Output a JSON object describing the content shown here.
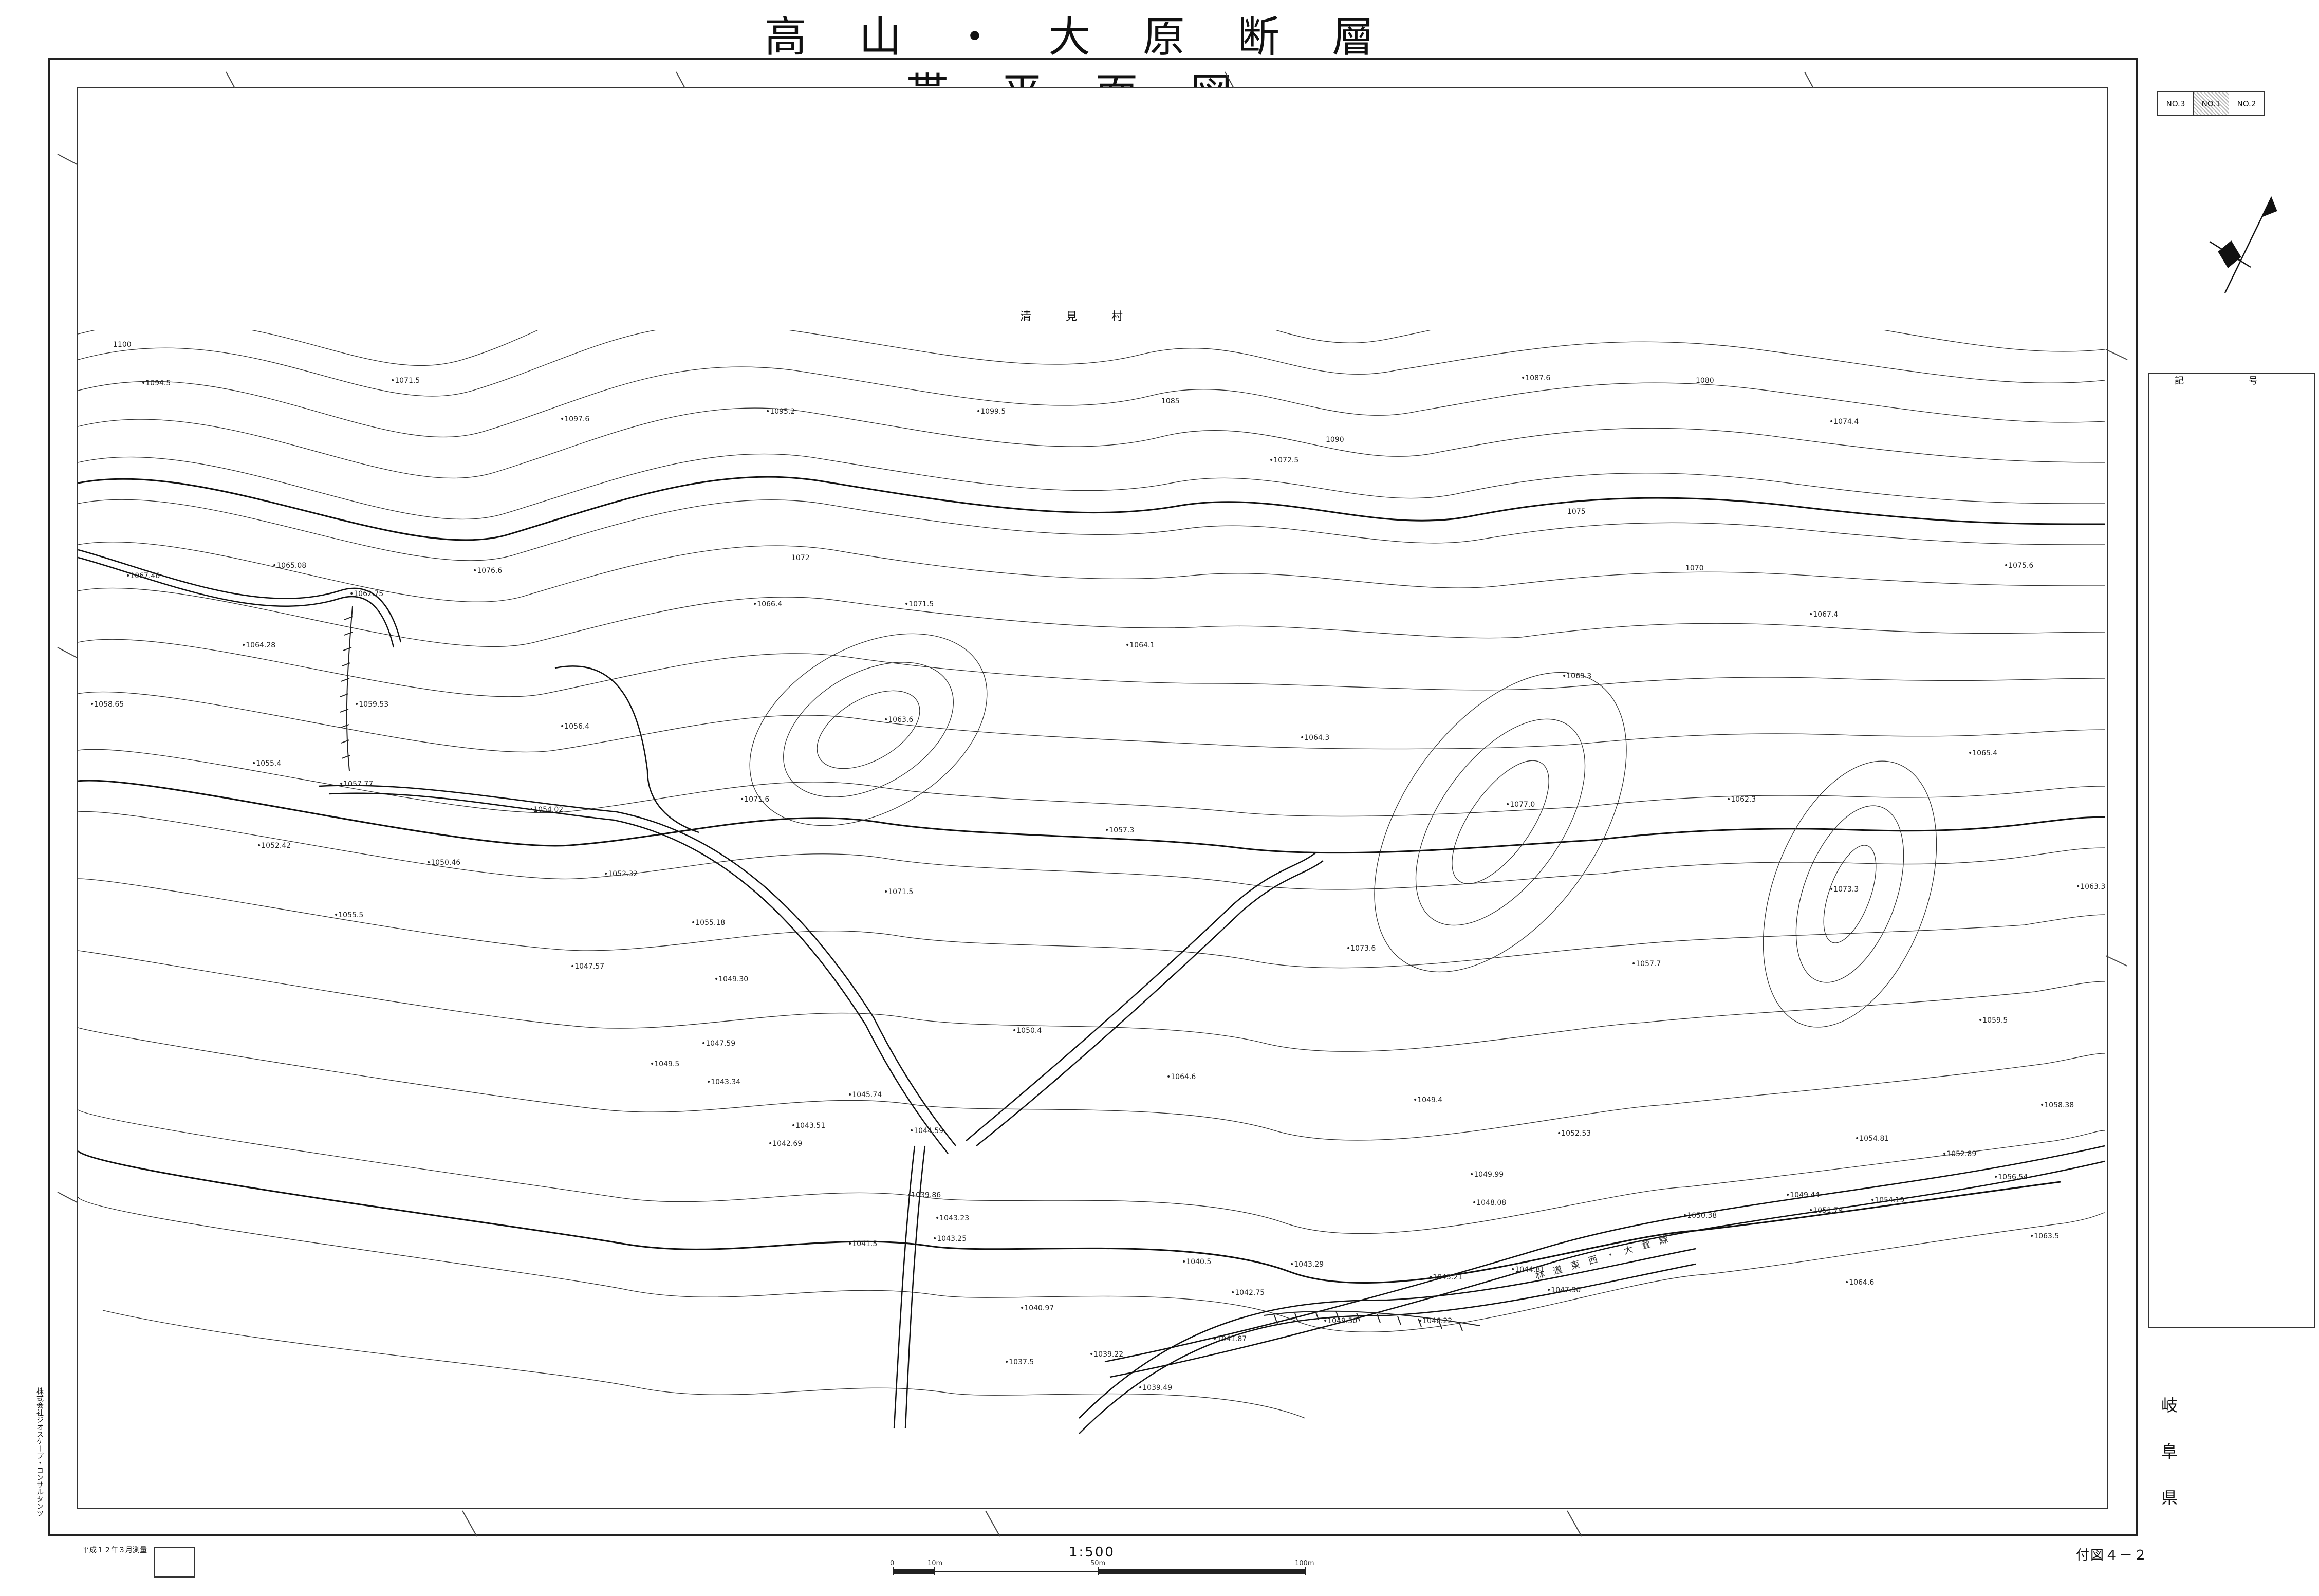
{
  "title": "高 山 ・ 大 原 断 層 帯 平 面 図",
  "village": "清 見 村",
  "sheet_index": [
    "NO.3",
    "NO.1",
    "NO.2"
  ],
  "sheet_index_current": 1,
  "legend": {
    "title": "記 号"
  },
  "prefecture": [
    "岐",
    "阜",
    "県"
  ],
  "scale": "1:500",
  "scale_bar": {
    "labels": [
      "0",
      "10m",
      "50m",
      "100m"
    ]
  },
  "sheet_number": "付図４－２",
  "survey_note": "平成１２年３月測量",
  "company": "株式会社ジオスケープ・コンサルタンツ",
  "elevations": [
    {
      "label": "1100"
    },
    {
      "label": "•1094.5"
    },
    {
      "label": "•1071.5"
    },
    {
      "label": "•1097.6"
    },
    {
      "label": "•1095.2"
    },
    {
      "label": "•1099.5"
    },
    {
      "label": "1085"
    },
    {
      "label": "•1087.6"
    },
    {
      "label": "•1074.4"
    },
    {
      "label": "1080"
    },
    {
      "label": "1090"
    },
    {
      "label": "•1072.5"
    },
    {
      "label": "1075"
    },
    {
      "label": "•1075.6"
    },
    {
      "label": "•1067.46"
    },
    {
      "label": "•1065.08"
    },
    {
      "label": "•1076.6"
    },
    {
      "label": "1072"
    },
    {
      "label": "•1066.4"
    },
    {
      "label": "•1071.5"
    },
    {
      "label": "1070"
    },
    {
      "label": "•1067.4"
    },
    {
      "label": "•1062.75"
    },
    {
      "label": "•1064.28"
    },
    {
      "label": "•1064.1"
    },
    {
      "label": "•1069.3"
    },
    {
      "label": "•1058.65"
    },
    {
      "label": "•1059.53"
    },
    {
      "label": "•1056.4"
    },
    {
      "label": "•1063.6"
    },
    {
      "label": "•1064.3"
    },
    {
      "label": "•1065.4"
    },
    {
      "label": "•1055.4"
    },
    {
      "label": "•1057.77"
    },
    {
      "label": "•1054.02"
    },
    {
      "label": "•1071.6"
    },
    {
      "label": "•1077.0"
    },
    {
      "label": "•1062.3"
    },
    {
      "label": "•1052.42"
    },
    {
      "label": "•1050.46"
    },
    {
      "label": "•1057.3"
    },
    {
      "label": "•1073.3"
    },
    {
      "label": "•1063.3"
    },
    {
      "label": "•1052.32"
    },
    {
      "label": "•1071.5"
    },
    {
      "label": "•1055.5"
    },
    {
      "label": "•1055.18"
    },
    {
      "label": "•1073.6"
    },
    {
      "label": "•1057.7"
    },
    {
      "label": "•1047.57"
    },
    {
      "label": "•1049.30"
    },
    {
      "label": "•1050.4"
    },
    {
      "label": "•1059.5"
    },
    {
      "label": "•1049.5"
    },
    {
      "label": "•1047.59"
    },
    {
      "label": "•1043.34"
    },
    {
      "label": "•1064.6"
    },
    {
      "label": "•1045.74"
    },
    {
      "label": "•1049.4"
    },
    {
      "label": "•1058.38"
    },
    {
      "label": "•1043.51"
    },
    {
      "label": "•1044.59"
    },
    {
      "label": "•1042.69"
    },
    {
      "label": "•1052.53"
    },
    {
      "label": "•1054.81"
    },
    {
      "label": "•1052.89"
    },
    {
      "label": "•1039.86"
    },
    {
      "label": "•1049.99"
    },
    {
      "label": "•1056.54"
    },
    {
      "label": "•1043.23"
    },
    {
      "label": "•1048.08"
    },
    {
      "label": "•1049.44"
    },
    {
      "label": "•1054.19"
    },
    {
      "label": "•1051.79"
    },
    {
      "label": "•1050.38"
    },
    {
      "label": "•1041.5"
    },
    {
      "label": "•1043.25"
    },
    {
      "label": "•1040.5"
    },
    {
      "label": "•1043.29"
    },
    {
      "label": "•1045.21"
    },
    {
      "label": "•1044.81"
    },
    {
      "label": "•1063.5"
    },
    {
      "label": "•1042.75"
    },
    {
      "label": "•1047.90"
    },
    {
      "label": "•1064.6"
    },
    {
      "label": "•1040.97"
    },
    {
      "label": "•1049.50"
    },
    {
      "label": "•1046.22"
    },
    {
      "label": "•1041.87"
    },
    {
      "label": "•1037.5"
    },
    {
      "label": "•1039.22"
    },
    {
      "label": "•1039.49"
    }
  ],
  "road_label": "林 道 東 西 ・ 大 萱 線"
}
